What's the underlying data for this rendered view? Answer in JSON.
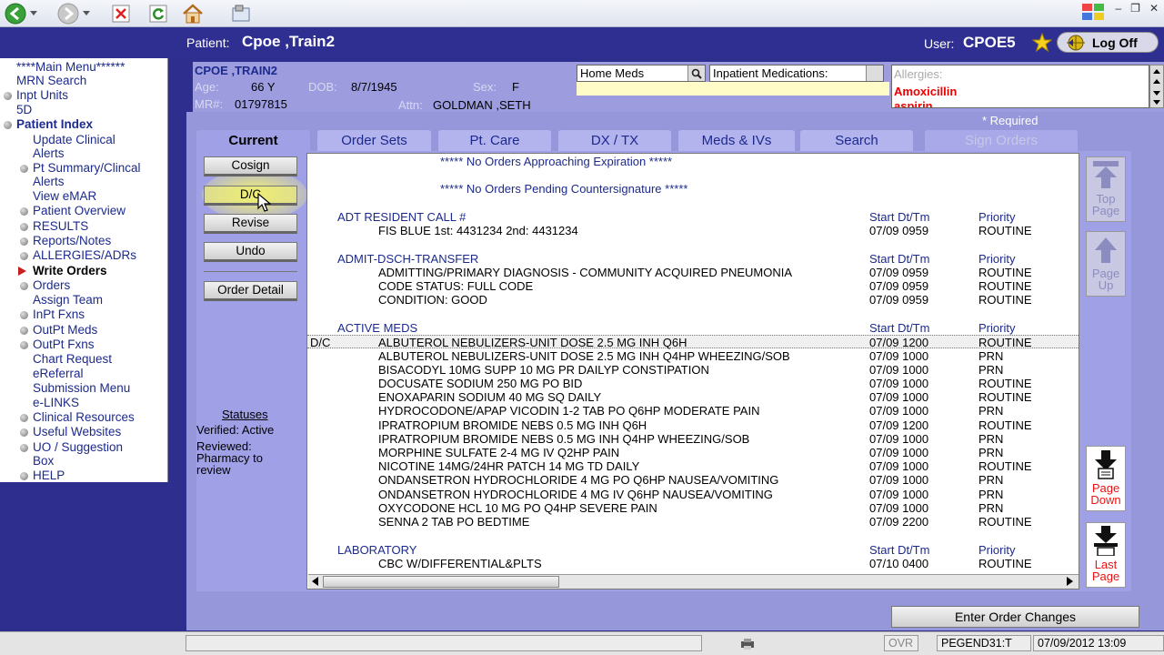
{
  "header": {
    "patient_label": "Patient:",
    "patient_name": "Cpoe ,Train2",
    "user_label": "User:",
    "user_name": "CPOE5",
    "logoff_label": "Log Off"
  },
  "nav": {
    "items": [
      {
        "label": "****Main Menu******"
      },
      {
        "label": "MRN Search"
      },
      {
        "label": "Inpt Units"
      },
      {
        "label": "5D"
      },
      {
        "label": "Patient Index"
      },
      {
        "label": "Update Clinical"
      },
      {
        "label": "Alerts"
      },
      {
        "label": "Pt Summary/Clincal"
      },
      {
        "label": "Alerts"
      },
      {
        "label": "View eMAR"
      },
      {
        "label": "Patient Overview"
      },
      {
        "label": "RESULTS"
      },
      {
        "label": "Reports/Notes"
      },
      {
        "label": "ALLERGIES/ADRs"
      },
      {
        "label": "Write Orders"
      },
      {
        "label": "Orders"
      },
      {
        "label": "Assign Team"
      },
      {
        "label": "InPt Fxns"
      },
      {
        "label": "OutPt Meds"
      },
      {
        "label": "OutPt Fxns"
      },
      {
        "label": "Chart Request"
      },
      {
        "label": "eReferral"
      },
      {
        "label": "Submission Menu"
      },
      {
        "label": "e-LINKS"
      },
      {
        "label": "Clinical Resources"
      },
      {
        "label": "Useful Websites"
      },
      {
        "label": "UO / Suggestion"
      },
      {
        "label": "Box"
      },
      {
        "label": "HELP"
      }
    ]
  },
  "patient_info": {
    "name_link": "CPOE ,TRAIN2",
    "age_label": "Age:",
    "age": "66 Y",
    "dob_label": "DOB:",
    "dob": "8/7/1945",
    "sex_label": "Sex:",
    "sex": "F",
    "mr_label": "MR#:",
    "mr": "01797815",
    "attn_label": "Attn:",
    "attn": "GOLDMAN ,SETH",
    "home_meds": "Home Meds",
    "inpatient_meds": "Inpatient Medications:",
    "allergies_label": "Allergies:",
    "allergies": [
      "Amoxicillin",
      "aspirin"
    ],
    "required_note": "* Required"
  },
  "tabs": [
    {
      "label": "Current"
    },
    {
      "label": "Order Sets"
    },
    {
      "label": "Pt. Care"
    },
    {
      "label": "DX / TX"
    },
    {
      "label": "Meds & IVs"
    },
    {
      "label": "Search"
    },
    {
      "label": "Sign Orders"
    }
  ],
  "actions": {
    "cosign": "Cosign",
    "dc": "D/C",
    "revise": "Revise",
    "undo": "Undo",
    "order_detail": "Order Detail"
  },
  "statuses": {
    "title": "Statuses",
    "verified": "Verified: Active",
    "reviewed": "Reviewed: Pharmacy to review"
  },
  "orders": {
    "notice_expiration": "*****  No Orders Approaching Expiration  *****",
    "notice_countersign": "*****  No Orders Pending Countersignature  *****",
    "col_start": "Start Dt/Tm",
    "col_priority": "Priority",
    "sections": [
      {
        "category": "ADT RESIDENT CALL #",
        "rows": [
          {
            "flag": "",
            "desc": "FIS BLUE 1st: 4431234 2nd: 4431234",
            "start": "07/09 0959",
            "priority": "ROUTINE"
          }
        ]
      },
      {
        "category": "ADMIT-DSCH-TRANSFER",
        "rows": [
          {
            "flag": "",
            "desc": "ADMITTING/PRIMARY DIAGNOSIS - COMMUNITY ACQUIRED PNEUMONIA",
            "start": "07/09 0959",
            "priority": "ROUTINE"
          },
          {
            "flag": "",
            "desc": "CODE STATUS: FULL CODE",
            "start": "07/09 0959",
            "priority": "ROUTINE"
          },
          {
            "flag": "",
            "desc": "CONDITION: GOOD",
            "start": "07/09 0959",
            "priority": "ROUTINE"
          }
        ]
      },
      {
        "category": "ACTIVE MEDS",
        "rows": [
          {
            "flag": "D/C",
            "desc": "ALBUTEROL NEBULIZERS-UNIT DOSE 2.5 MG INH Q6H",
            "start": "07/09 1200",
            "priority": "ROUTINE"
          },
          {
            "flag": "",
            "desc": "ALBUTEROL NEBULIZERS-UNIT DOSE 2.5 MG INH Q4HP WHEEZING/SOB",
            "start": "07/09 1000",
            "priority": "PRN"
          },
          {
            "flag": "",
            "desc": "BISACODYL 10MG SUPP 10 MG PR DAILYP CONSTIPATION",
            "start": "07/09 1000",
            "priority": "PRN"
          },
          {
            "flag": "",
            "desc": "DOCUSATE SODIUM 250 MG PO BID",
            "start": "07/09 1000",
            "priority": "ROUTINE"
          },
          {
            "flag": "",
            "desc": "ENOXAPARIN SODIUM 40 MG SQ DAILY",
            "start": "07/09 1000",
            "priority": "ROUTINE"
          },
          {
            "flag": "",
            "desc": "HYDROCODONE/APAP VICODIN 1-2 TAB PO Q6HP MODERATE PAIN",
            "start": "07/09 1000",
            "priority": "PRN"
          },
          {
            "flag": "",
            "desc": "IPRATROPIUM BROMIDE NEBS 0.5 MG INH Q6H",
            "start": "07/09 1200",
            "priority": "ROUTINE"
          },
          {
            "flag": "",
            "desc": "IPRATROPIUM BROMIDE NEBS 0.5 MG INH Q4HP WHEEZING/SOB",
            "start": "07/09 1000",
            "priority": "PRN"
          },
          {
            "flag": "",
            "desc": "MORPHINE SULFATE 2-4 MG IV Q2HP PAIN",
            "start": "07/09 1000",
            "priority": "PRN"
          },
          {
            "flag": "",
            "desc": "NICOTINE 14MG/24HR PATCH 14 MG TD DAILY",
            "start": "07/09 1000",
            "priority": "ROUTINE"
          },
          {
            "flag": "",
            "desc": "ONDANSETRON HYDROCHLORIDE 4 MG PO Q6HP NAUSEA/VOMITING",
            "start": "07/09 1000",
            "priority": "PRN"
          },
          {
            "flag": "",
            "desc": "ONDANSETRON HYDROCHLORIDE 4 MG IV Q6HP NAUSEA/VOMITING",
            "start": "07/09 1000",
            "priority": "PRN"
          },
          {
            "flag": "",
            "desc": "OXYCODONE HCL 10 MG PO Q4HP SEVERE PAIN",
            "start": "07/09 1000",
            "priority": "PRN"
          },
          {
            "flag": "",
            "desc": "SENNA 2 TAB PO BEDTIME",
            "start": "07/09 2200",
            "priority": "ROUTINE"
          }
        ]
      },
      {
        "category": "LABORATORY",
        "rows": [
          {
            "flag": "",
            "desc": "CBC W/DIFFERENTIAL&PLTS",
            "start": "07/10 0400",
            "priority": "ROUTINE"
          }
        ]
      }
    ]
  },
  "paging": {
    "top": "Top Page",
    "up": "Page Up",
    "down": "Page Down",
    "last": "Last Page"
  },
  "enter_changes": "Enter Order Changes",
  "status_bar": {
    "ovr": "OVR",
    "device": "PEGEND31:T",
    "datetime": "07/09/2012 13:09"
  },
  "colors": {
    "header_bg": "#2f2f92",
    "panel_bg": "#9c9cdf",
    "link_blue": "#1c2a8c",
    "allergy_red": "#e00000",
    "highlight_yellow": "#ffff5a"
  }
}
